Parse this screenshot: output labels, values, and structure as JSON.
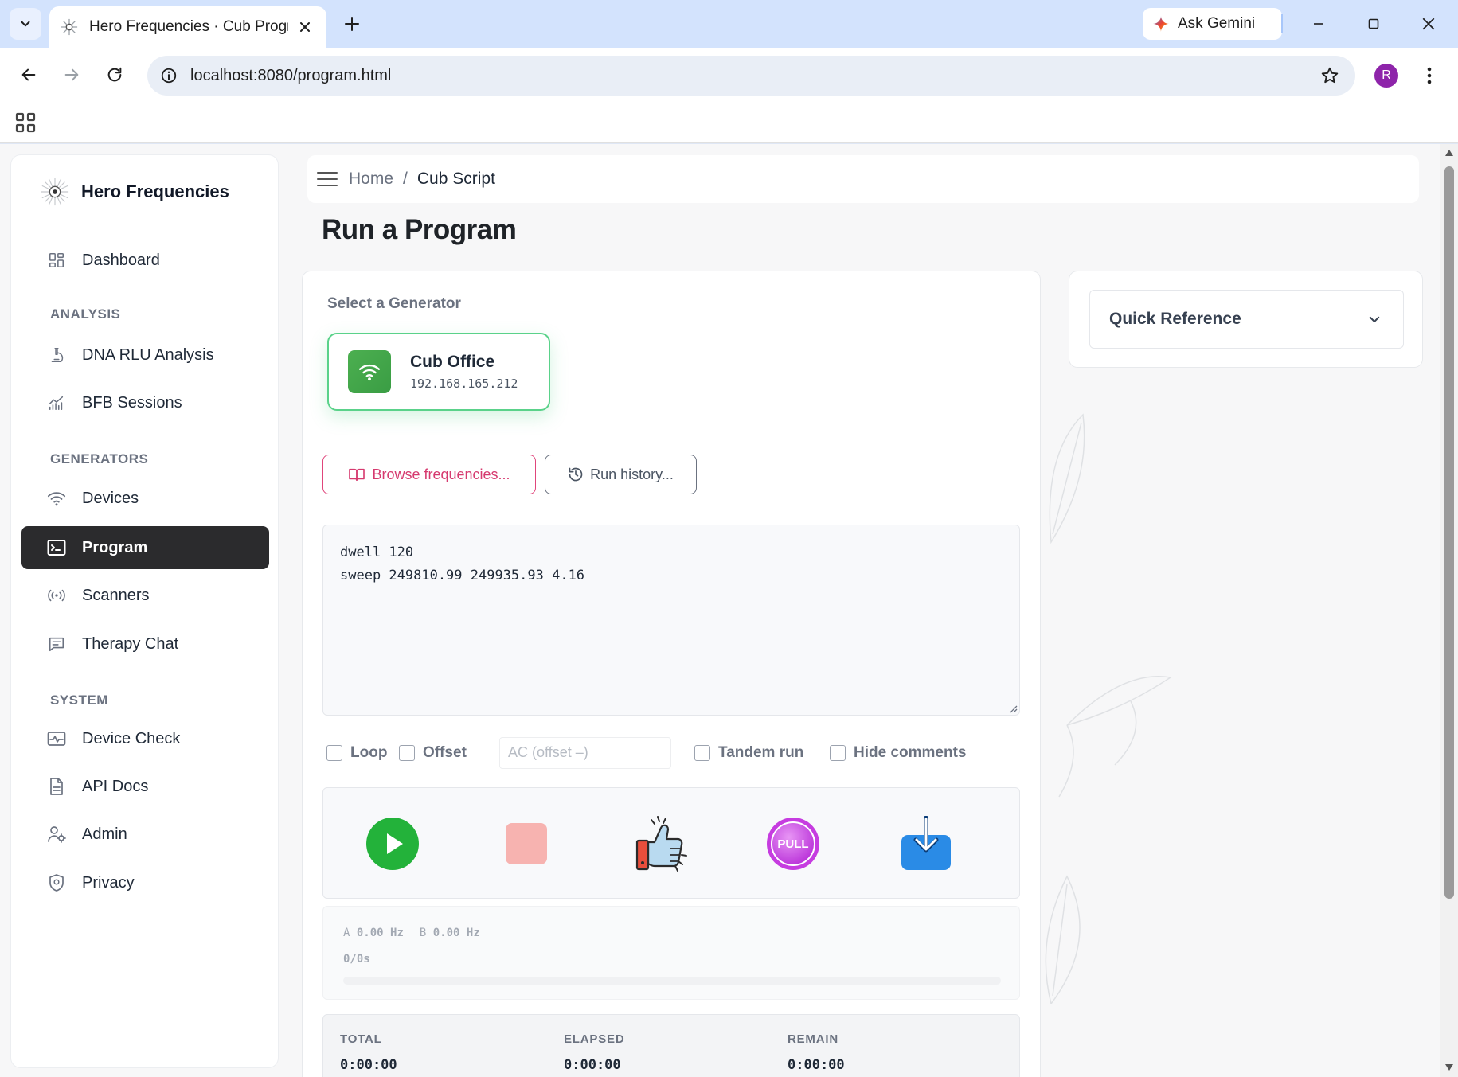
{
  "browser": {
    "tab_title": "Hero Frequencies · Cub Program",
    "new_tab_symbol": "+",
    "gemini_label": "Ask Gemini",
    "url": "localhost:8080/program.html",
    "profile_initial": "R"
  },
  "sidebar": {
    "brand": "Hero Frequencies",
    "items": [
      {
        "label": "Dashboard",
        "icon": "dashboard-icon"
      },
      {
        "label": "DNA RLU Analysis",
        "icon": "microscope-icon"
      },
      {
        "label": "BFB Sessions",
        "icon": "chart-icon"
      },
      {
        "label": "Devices",
        "icon": "wifi-icon"
      },
      {
        "label": "Program",
        "icon": "terminal-icon",
        "active": true
      },
      {
        "label": "Scanners",
        "icon": "broadcast-icon"
      },
      {
        "label": "Therapy Chat",
        "icon": "chat-icon"
      },
      {
        "label": "Device Check",
        "icon": "pulse-icon"
      },
      {
        "label": "API Docs",
        "icon": "document-icon"
      },
      {
        "label": "Admin",
        "icon": "user-gear-icon"
      },
      {
        "label": "Privacy",
        "icon": "shield-icon"
      }
    ],
    "sections": {
      "analysis": "ANALYSIS",
      "generators": "GENERATORS",
      "system": "SYSTEM"
    }
  },
  "breadcrumb": {
    "home": "Home",
    "separator": "/",
    "current": "Cub Script"
  },
  "page": {
    "title": "Run a Program"
  },
  "generator": {
    "label": "Select a Generator",
    "name": "Cub Office",
    "ip": "192.168.165.212"
  },
  "buttons": {
    "browse": "Browse frequencies...",
    "history": "Run history..."
  },
  "editor": {
    "lines": [
      "dwell 120",
      "sweep 249810.99 249935.93 4.16"
    ]
  },
  "options": {
    "loop": "Loop",
    "offset": "Offset",
    "ac_placeholder": "AC (offset –)",
    "tandem": "Tandem run",
    "hide_comments": "Hide comments"
  },
  "controls": {
    "pull_label": "PULL"
  },
  "status": {
    "a_label": "A",
    "a_value": "0.00 Hz",
    "b_label": "B",
    "b_value": "0.00 Hz",
    "progress_text": "0/0s",
    "progress_fraction": 0
  },
  "totals": {
    "total_label": "TOTAL",
    "total_value": "0:00:00",
    "elapsed_label": "ELAPSED",
    "elapsed_value": "0:00:00",
    "remain_label": "REMAIN",
    "remain_value": "0:00:00"
  },
  "quick_reference": {
    "title": "Quick Reference"
  },
  "colors": {
    "accent_green": "#4caf50",
    "browse_pink": "#e0457b",
    "active_nav": "#2b2b2d",
    "play_green": "#23b23a",
    "stop_pink": "#f7b3b0",
    "pull_purple": "#c63ce0",
    "download_blue": "#2a8be6"
  }
}
